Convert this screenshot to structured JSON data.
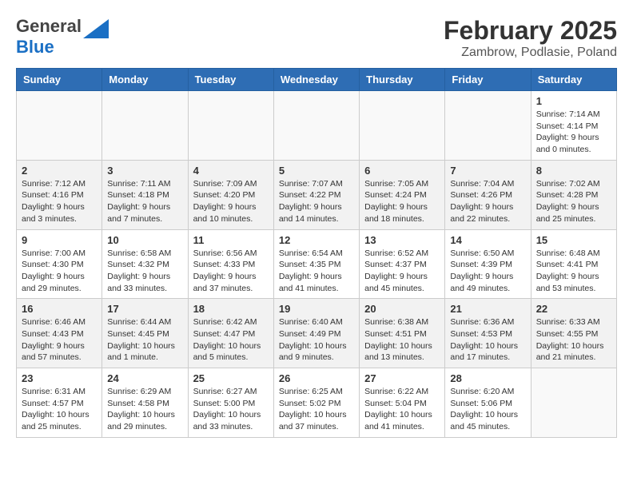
{
  "header": {
    "logo_general": "General",
    "logo_blue": "Blue",
    "month_title": "February 2025",
    "location": "Zambrow, Podlasie, Poland"
  },
  "weekdays": [
    "Sunday",
    "Monday",
    "Tuesday",
    "Wednesday",
    "Thursday",
    "Friday",
    "Saturday"
  ],
  "weeks": [
    [
      {
        "day": "",
        "info": ""
      },
      {
        "day": "",
        "info": ""
      },
      {
        "day": "",
        "info": ""
      },
      {
        "day": "",
        "info": ""
      },
      {
        "day": "",
        "info": ""
      },
      {
        "day": "",
        "info": ""
      },
      {
        "day": "1",
        "info": "Sunrise: 7:14 AM\nSunset: 4:14 PM\nDaylight: 9 hours and 0 minutes."
      }
    ],
    [
      {
        "day": "2",
        "info": "Sunrise: 7:12 AM\nSunset: 4:16 PM\nDaylight: 9 hours and 3 minutes."
      },
      {
        "day": "3",
        "info": "Sunrise: 7:11 AM\nSunset: 4:18 PM\nDaylight: 9 hours and 7 minutes."
      },
      {
        "day": "4",
        "info": "Sunrise: 7:09 AM\nSunset: 4:20 PM\nDaylight: 9 hours and 10 minutes."
      },
      {
        "day": "5",
        "info": "Sunrise: 7:07 AM\nSunset: 4:22 PM\nDaylight: 9 hours and 14 minutes."
      },
      {
        "day": "6",
        "info": "Sunrise: 7:05 AM\nSunset: 4:24 PM\nDaylight: 9 hours and 18 minutes."
      },
      {
        "day": "7",
        "info": "Sunrise: 7:04 AM\nSunset: 4:26 PM\nDaylight: 9 hours and 22 minutes."
      },
      {
        "day": "8",
        "info": "Sunrise: 7:02 AM\nSunset: 4:28 PM\nDaylight: 9 hours and 25 minutes."
      }
    ],
    [
      {
        "day": "9",
        "info": "Sunrise: 7:00 AM\nSunset: 4:30 PM\nDaylight: 9 hours and 29 minutes."
      },
      {
        "day": "10",
        "info": "Sunrise: 6:58 AM\nSunset: 4:32 PM\nDaylight: 9 hours and 33 minutes."
      },
      {
        "day": "11",
        "info": "Sunrise: 6:56 AM\nSunset: 4:33 PM\nDaylight: 9 hours and 37 minutes."
      },
      {
        "day": "12",
        "info": "Sunrise: 6:54 AM\nSunset: 4:35 PM\nDaylight: 9 hours and 41 minutes."
      },
      {
        "day": "13",
        "info": "Sunrise: 6:52 AM\nSunset: 4:37 PM\nDaylight: 9 hours and 45 minutes."
      },
      {
        "day": "14",
        "info": "Sunrise: 6:50 AM\nSunset: 4:39 PM\nDaylight: 9 hours and 49 minutes."
      },
      {
        "day": "15",
        "info": "Sunrise: 6:48 AM\nSunset: 4:41 PM\nDaylight: 9 hours and 53 minutes."
      }
    ],
    [
      {
        "day": "16",
        "info": "Sunrise: 6:46 AM\nSunset: 4:43 PM\nDaylight: 9 hours and 57 minutes."
      },
      {
        "day": "17",
        "info": "Sunrise: 6:44 AM\nSunset: 4:45 PM\nDaylight: 10 hours and 1 minute."
      },
      {
        "day": "18",
        "info": "Sunrise: 6:42 AM\nSunset: 4:47 PM\nDaylight: 10 hours and 5 minutes."
      },
      {
        "day": "19",
        "info": "Sunrise: 6:40 AM\nSunset: 4:49 PM\nDaylight: 10 hours and 9 minutes."
      },
      {
        "day": "20",
        "info": "Sunrise: 6:38 AM\nSunset: 4:51 PM\nDaylight: 10 hours and 13 minutes."
      },
      {
        "day": "21",
        "info": "Sunrise: 6:36 AM\nSunset: 4:53 PM\nDaylight: 10 hours and 17 minutes."
      },
      {
        "day": "22",
        "info": "Sunrise: 6:33 AM\nSunset: 4:55 PM\nDaylight: 10 hours and 21 minutes."
      }
    ],
    [
      {
        "day": "23",
        "info": "Sunrise: 6:31 AM\nSunset: 4:57 PM\nDaylight: 10 hours and 25 minutes."
      },
      {
        "day": "24",
        "info": "Sunrise: 6:29 AM\nSunset: 4:58 PM\nDaylight: 10 hours and 29 minutes."
      },
      {
        "day": "25",
        "info": "Sunrise: 6:27 AM\nSunset: 5:00 PM\nDaylight: 10 hours and 33 minutes."
      },
      {
        "day": "26",
        "info": "Sunrise: 6:25 AM\nSunset: 5:02 PM\nDaylight: 10 hours and 37 minutes."
      },
      {
        "day": "27",
        "info": "Sunrise: 6:22 AM\nSunset: 5:04 PM\nDaylight: 10 hours and 41 minutes."
      },
      {
        "day": "28",
        "info": "Sunrise: 6:20 AM\nSunset: 5:06 PM\nDaylight: 10 hours and 45 minutes."
      },
      {
        "day": "",
        "info": ""
      }
    ]
  ]
}
